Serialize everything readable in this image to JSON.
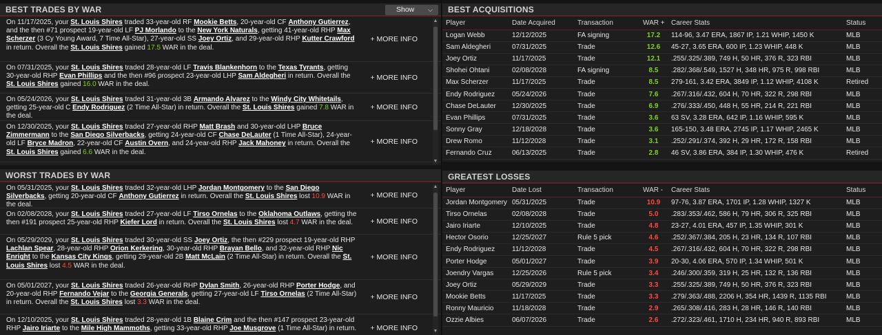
{
  "best_trades": {
    "title": "BEST TRADES BY WAR",
    "show_label": "Show",
    "more_label": "+ MORE INFO",
    "items": [
      {
        "parts": [
          [
            "t",
            "On 11/17/2025, your "
          ],
          [
            "u",
            "St. Louis Shires"
          ],
          [
            "t",
            " traded 33-year-old RF "
          ],
          [
            "u",
            "Mookie Betts"
          ],
          [
            "t",
            ", 20-year-old CF "
          ],
          [
            "u",
            "Anthony Gutierrez"
          ],
          [
            "t",
            ", and the then #71 prospect 19-year-old LF "
          ],
          [
            "u",
            "PJ Morlando"
          ],
          [
            "t",
            " to the "
          ],
          [
            "u",
            "New York Naturals"
          ],
          [
            "t",
            ", getting 41-year-old RHP "
          ],
          [
            "u",
            "Max Scherzer"
          ],
          [
            "t",
            " (3 Cy Young Award, 7 Time All-Star), 27-year-old SS "
          ],
          [
            "u",
            "Joey Ortiz"
          ],
          [
            "t",
            ", and 29-year-old RHP "
          ],
          [
            "u",
            "Kutter Crawford"
          ],
          [
            "t",
            " in return. Overall the "
          ],
          [
            "u",
            "St. Louis Shires"
          ],
          [
            "t",
            " gained "
          ],
          [
            "g",
            "17.5"
          ],
          [
            "t",
            " WAR in the deal."
          ]
        ]
      },
      {
        "parts": [
          [
            "t",
            "On 07/31/2025, your "
          ],
          [
            "u",
            "St. Louis Shires"
          ],
          [
            "t",
            " traded 28-year-old LF "
          ],
          [
            "u",
            "Travis Blankenhorn"
          ],
          [
            "t",
            " to the "
          ],
          [
            "u",
            "Texas Tyrants"
          ],
          [
            "t",
            ", getting 30-year-old RHP "
          ],
          [
            "u",
            "Evan Phillips"
          ],
          [
            "t",
            " and the then #96 prospect 23-year-old LHP "
          ],
          [
            "u",
            "Sam Aldegheri"
          ],
          [
            "t",
            " in return. Overall the "
          ],
          [
            "u",
            "St. Louis Shires"
          ],
          [
            "t",
            " gained "
          ],
          [
            "g",
            "16.0"
          ],
          [
            "t",
            " WAR in the deal."
          ]
        ]
      },
      {
        "parts": [
          [
            "t",
            "On 05/24/2026, your "
          ],
          [
            "u",
            "St. Louis Shires"
          ],
          [
            "t",
            " traded 31-year-old 3B "
          ],
          [
            "u",
            "Armando Alvarez"
          ],
          [
            "t",
            " to the "
          ],
          [
            "u",
            "Windy City Whitetails"
          ],
          [
            "t",
            ", getting 25-year-old C "
          ],
          [
            "u",
            "Endy Rodriguez"
          ],
          [
            "t",
            " (2 Time All-Star) in return. Overall the "
          ],
          [
            "u",
            "St. Louis Shires"
          ],
          [
            "t",
            " gained "
          ],
          [
            "g",
            "7.8"
          ],
          [
            "t",
            " WAR in the deal."
          ]
        ]
      },
      {
        "parts": [
          [
            "t",
            "On 12/30/2025, your "
          ],
          [
            "u",
            "St. Louis Shires"
          ],
          [
            "t",
            " traded 27-year-old RHP "
          ],
          [
            "u",
            "Matt Brash"
          ],
          [
            "t",
            " and 30-year-old LHP "
          ],
          [
            "u",
            "Bruce Zimmermann"
          ],
          [
            "t",
            " to the "
          ],
          [
            "u",
            "San Diego Silverbacks"
          ],
          [
            "t",
            ", getting 24-year-old CF "
          ],
          [
            "u",
            "Chase DeLauter"
          ],
          [
            "t",
            " (1 Time All-Star), 24-year-old LF "
          ],
          [
            "u",
            "Bryce Madron"
          ],
          [
            "t",
            ", 22-year-old CF "
          ],
          [
            "u",
            "Austin Overn"
          ],
          [
            "t",
            ", and 24-year-old RHP "
          ],
          [
            "u",
            "Jack Mahoney"
          ],
          [
            "t",
            " in return. Overall the "
          ],
          [
            "u",
            "St. Louis Shires"
          ],
          [
            "t",
            " gained "
          ],
          [
            "g",
            "6.6"
          ],
          [
            "t",
            " WAR in the deal."
          ]
        ]
      }
    ]
  },
  "worst_trades": {
    "title": "WORST TRADES BY WAR",
    "more_label": "+ MORE INFO",
    "items": [
      {
        "parts": [
          [
            "t",
            "On 05/31/2025, your "
          ],
          [
            "u",
            "St. Louis Shires"
          ],
          [
            "t",
            " traded 32-year-old LHP "
          ],
          [
            "u",
            "Jordan Montgomery"
          ],
          [
            "t",
            " to the "
          ],
          [
            "u",
            "San Diego Silverbacks"
          ],
          [
            "t",
            ", getting 20-year-old CF "
          ],
          [
            "u",
            "Anthony Gutierrez"
          ],
          [
            "t",
            " in return. Overall the "
          ],
          [
            "u",
            "St. Louis Shires"
          ],
          [
            "t",
            " lost "
          ],
          [
            "r",
            "10.9"
          ],
          [
            "t",
            " WAR in the deal."
          ]
        ]
      },
      {
        "parts": [
          [
            "t",
            "On 02/08/2028, your "
          ],
          [
            "u",
            "St. Louis Shires"
          ],
          [
            "t",
            " traded 27-year-old LF "
          ],
          [
            "u",
            "Tirso Ornelas"
          ],
          [
            "t",
            " to the "
          ],
          [
            "u",
            "Oklahoma Outlaws"
          ],
          [
            "t",
            ", getting the then #191 prospect 25-year-old RHP "
          ],
          [
            "u",
            "Kiefer Lord"
          ],
          [
            "t",
            " in return. Overall the "
          ],
          [
            "u",
            "St. Louis Shires"
          ],
          [
            "t",
            " lost "
          ],
          [
            "r",
            "4.7"
          ],
          [
            "t",
            " WAR in the deal."
          ]
        ]
      },
      {
        "parts": [
          [
            "t",
            "On 05/29/2029, your "
          ],
          [
            "u",
            "St. Louis Shires"
          ],
          [
            "t",
            " traded 30-year-old SS "
          ],
          [
            "u",
            "Joey Ortiz"
          ],
          [
            "t",
            ", the then #229 prospect 19-year-old RHP "
          ],
          [
            "u",
            "Lachlan Spear"
          ],
          [
            "t",
            ", 28-year-old RHP "
          ],
          [
            "u",
            "Orion Kerkering"
          ],
          [
            "t",
            ", 30-year-old RHP "
          ],
          [
            "u",
            "Brayan Bello"
          ],
          [
            "t",
            ", and 32-year-old RHP "
          ],
          [
            "u",
            "Nic Enright"
          ],
          [
            "t",
            " to the "
          ],
          [
            "u",
            "Kansas City Kings"
          ],
          [
            "t",
            ", getting 29-year-old 2B "
          ],
          [
            "u",
            "Matt McLain"
          ],
          [
            "t",
            " (2 Time All-Star) in return. Overall the "
          ],
          [
            "u",
            "St. Louis Shires"
          ],
          [
            "t",
            " lost "
          ],
          [
            "r",
            "4.5"
          ],
          [
            "t",
            " WAR in the deal."
          ]
        ]
      },
      {
        "parts": [
          [
            "t",
            "On 05/01/2027, your "
          ],
          [
            "u",
            "St. Louis Shires"
          ],
          [
            "t",
            " traded 26-year-old RHP "
          ],
          [
            "u",
            "Dylan Smith"
          ],
          [
            "t",
            ", 26-year-old RHP "
          ],
          [
            "u",
            "Porter Hodge"
          ],
          [
            "t",
            ", and 20-year-old RHP "
          ],
          [
            "u",
            "Fernando Vejar"
          ],
          [
            "t",
            " to the "
          ],
          [
            "u",
            "Georgia Generals"
          ],
          [
            "t",
            ", getting 27-year-old LF "
          ],
          [
            "u",
            "Tirso Ornelas"
          ],
          [
            "t",
            " (2 Time All-Star) in return. Overall the "
          ],
          [
            "u",
            "St. Louis Shires"
          ],
          [
            "t",
            " lost "
          ],
          [
            "r",
            "3.3"
          ],
          [
            "t",
            " WAR in the deal."
          ]
        ]
      },
      {
        "parts": [
          [
            "t",
            "On 12/10/2025, your "
          ],
          [
            "u",
            "St. Louis Shires"
          ],
          [
            "t",
            " traded 28-year-old 1B "
          ],
          [
            "u",
            "Blaine Crim"
          ],
          [
            "t",
            " and the then #147 prospect 23-year-old RHP "
          ],
          [
            "u",
            "Jairo Iriarte"
          ],
          [
            "t",
            " to the "
          ],
          [
            "u",
            "Mile High Mammoths"
          ],
          [
            "t",
            ", getting 33-year-old RHP "
          ],
          [
            "u",
            "Joe Musgrove"
          ],
          [
            "t",
            " (1 Time All-Star) in return."
          ]
        ]
      }
    ]
  },
  "best_acq": {
    "title": "BEST ACQUISITIONS",
    "columns": [
      "Player",
      "Date Acquired",
      "Transaction",
      "WAR +",
      "Career Stats",
      "Status"
    ],
    "rows": [
      [
        "Logan Webb",
        "12/12/2025",
        "FA signing",
        "17.2",
        "114-96, 3.47 ERA, 1867 IP, 1.21 WHIP, 1450 K",
        "MLB"
      ],
      [
        "Sam Aldegheri",
        "07/31/2025",
        "Trade",
        "12.6",
        "45-27, 3.65 ERA, 600 IP, 1.23 WHIP, 448 K",
        "MLB"
      ],
      [
        "Joey Ortiz",
        "11/17/2025",
        "Trade",
        "12.1",
        ".255/.325/.389, 749 H, 50 HR, 376 R, 323 RBI",
        "MLB"
      ],
      [
        "Shohei Ohtani",
        "02/08/2028",
        "FA signing",
        "8.5",
        ".282/.368/.549, 1527 H, 348 HR, 975 R, 998 RBI",
        "MLB"
      ],
      [
        "Max Scherzer",
        "11/17/2025",
        "Trade",
        "8.5",
        "279-161, 3.42 ERA, 3849 IP, 1.12 WHIP, 4108 K",
        "Retired"
      ],
      [
        "Endy Rodriguez",
        "05/24/2026",
        "Trade",
        "7.6",
        ".267/.316/.432, 604 H, 70 HR, 322 R, 298 RBI",
        "MLB"
      ],
      [
        "Chase DeLauter",
        "12/30/2025",
        "Trade",
        "6.9",
        ".276/.333/.450, 448 H, 55 HR, 214 R, 221 RBI",
        "MLB"
      ],
      [
        "Evan Phillips",
        "07/31/2025",
        "Trade",
        "3.6",
        "63 SV, 3.28 ERA, 642 IP, 1.16 WHIP, 595 K",
        "MLB"
      ],
      [
        "Sonny Gray",
        "12/18/2028",
        "Trade",
        "3.6",
        "165-150, 3.48 ERA, 2745 IP, 1.17 WHIP, 2465 K",
        "MLB"
      ],
      [
        "Drew Romo",
        "11/12/2028",
        "Trade",
        "3.1",
        ".252/.291/.374, 392 H, 29 HR, 172 R, 158 RBI",
        "MLB"
      ],
      [
        "Fernando Cruz",
        "06/13/2025",
        "Trade",
        "2.8",
        "46 SV, 3.86 ERA, 384 IP, 1.30 WHIP, 476 K",
        "Retired"
      ]
    ]
  },
  "losses": {
    "title": "GREATEST LOSSES",
    "columns": [
      "Player",
      "Date Lost",
      "Transaction",
      "WAR -",
      "Career Stats",
      "Status"
    ],
    "rows": [
      [
        "Jordan Montgomery",
        "05/31/2025",
        "Trade",
        "10.9",
        "97-76, 3.87 ERA, 1701 IP, 1.28 WHIP, 1327 K",
        "MLB"
      ],
      [
        "Tirso Ornelas",
        "02/08/2028",
        "Trade",
        "5.0",
        ".283/.353/.462, 586 H, 79 HR, 306 R, 325 RBI",
        "MLB"
      ],
      [
        "Jairo Iriarte",
        "12/10/2025",
        "Trade",
        "4.8",
        "23-27, 4.01 ERA, 457 IP, 1.35 WHIP, 301 K",
        "MLB"
      ],
      [
        "Hector Osorio",
        "12/25/2027",
        "Rule 5 pick",
        "4.6",
        ".252/.367/.384, 205 H, 23 HR, 134 R, 107 RBI",
        "MLB"
      ],
      [
        "Endy Rodriguez",
        "11/12/2028",
        "Trade",
        "4.5",
        ".267/.316/.432, 604 H, 70 HR, 322 R, 298 RBI",
        "MLB"
      ],
      [
        "Porter Hodge",
        "05/01/2027",
        "Trade",
        "3.9",
        "20-30, 4.06 ERA, 570 IP, 1.34 WHIP, 501 K",
        "MLB"
      ],
      [
        "Joendry Vargas",
        "12/25/2026",
        "Rule 5 pick",
        "3.4",
        ".246/.300/.359, 319 H, 25 HR, 132 R, 136 RBI",
        "MLB"
      ],
      [
        "Joey Ortiz",
        "05/29/2029",
        "Trade",
        "3.3",
        ".255/.325/.389, 749 H, 50 HR, 376 R, 323 RBI",
        "MLB"
      ],
      [
        "Mookie Betts",
        "11/17/2025",
        "Trade",
        "3.3",
        ".279/.363/.488, 2206 H, 354 HR, 1439 R, 1135 RBI",
        "MLB"
      ],
      [
        "Ronny Mauricio",
        "11/18/2028",
        "Trade",
        "2.9",
        ".265/.308/.416, 283 H, 28 HR, 146 R, 140 RBI",
        "MLB"
      ],
      [
        "Ozzie Albies",
        "06/07/2026",
        "Trade",
        "2.6",
        ".272/.323/.461, 1710 H, 234 HR, 940 R, 893 RBI",
        "MLB"
      ]
    ]
  },
  "colors": {
    "gain": "#7ed321",
    "loss": "#ff4a3d",
    "accent": "#5a232c"
  }
}
